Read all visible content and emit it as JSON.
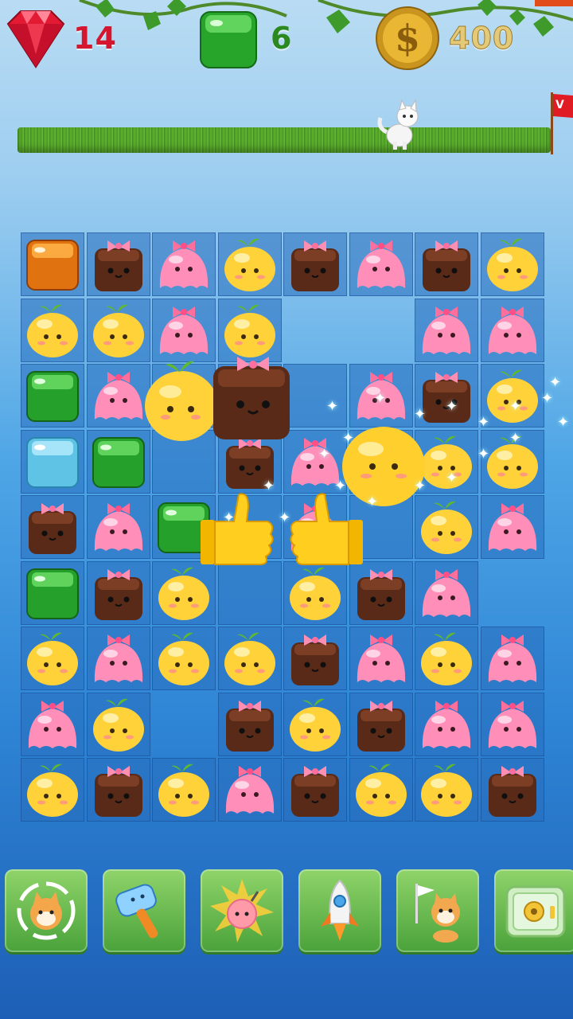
{
  "hud": {
    "ruby": {
      "icon": "ruby-gem-icon",
      "value": "14"
    },
    "jelly": {
      "icon": "green-jelly-cube-icon",
      "value": "6"
    },
    "coin": {
      "icon": "dollar-coin-icon",
      "value": "400"
    }
  },
  "level_progress": {
    "icon": "white-cat-icon",
    "goal_icon": "red-goal-flag-icon",
    "progress_fraction": 0.72
  },
  "board": {
    "columns": 8,
    "rows": 9,
    "grid": [
      [
        "amber-cube",
        "choco",
        "pink",
        "yellow",
        "choco",
        "pink",
        "choco",
        "yellow"
      ],
      [
        "yellow",
        "yellow",
        "pink",
        "yellow",
        null,
        null,
        "pink",
        "pink"
      ],
      [
        "green-cube",
        "pink",
        null,
        null,
        null,
        "pink",
        "choco",
        "yellow"
      ],
      [
        "blue-cube",
        "green-cube",
        null,
        "choco",
        "pink",
        null,
        "yellow",
        "yellow"
      ],
      [
        "choco",
        "pink",
        "green-cube",
        null,
        "pink",
        null,
        "yellow",
        "pink"
      ],
      [
        "green-cube",
        "choco",
        "yellow",
        null,
        "yellow",
        "choco",
        "pink",
        null
      ],
      [
        "yellow",
        "pink",
        "yellow",
        "yellow",
        "choco",
        "pink",
        "yellow",
        "pink"
      ],
      [
        "pink",
        "yellow",
        null,
        "choco",
        "yellow",
        "choco",
        "pink",
        "pink"
      ],
      [
        "yellow",
        "choco",
        "yellow",
        "pink",
        "choco",
        "yellow",
        "yellow",
        "choco"
      ]
    ],
    "empty_cells": [
      [
        1,
        4
      ],
      [
        1,
        5
      ],
      [
        5,
        7
      ],
      [
        7,
        2
      ]
    ]
  },
  "effects": [
    "thumbs-up-icon",
    "thumbs-up-icon",
    "sparkle-icon"
  ],
  "boosters": [
    {
      "icon": "shuffle-shiba-icon"
    },
    {
      "icon": "hammer-icon"
    },
    {
      "icon": "bomb-blast-icon"
    },
    {
      "icon": "rocket-icon"
    },
    {
      "icon": "shiba-flag-icon"
    },
    {
      "icon": "safe-box-icon"
    }
  ],
  "colors": {
    "ruby": "#d4162e",
    "jelly": "#2b8a1f",
    "coin": "#e0b93a",
    "board_cell": "#2f6eb8",
    "booster_bg": "#6cc04e"
  }
}
